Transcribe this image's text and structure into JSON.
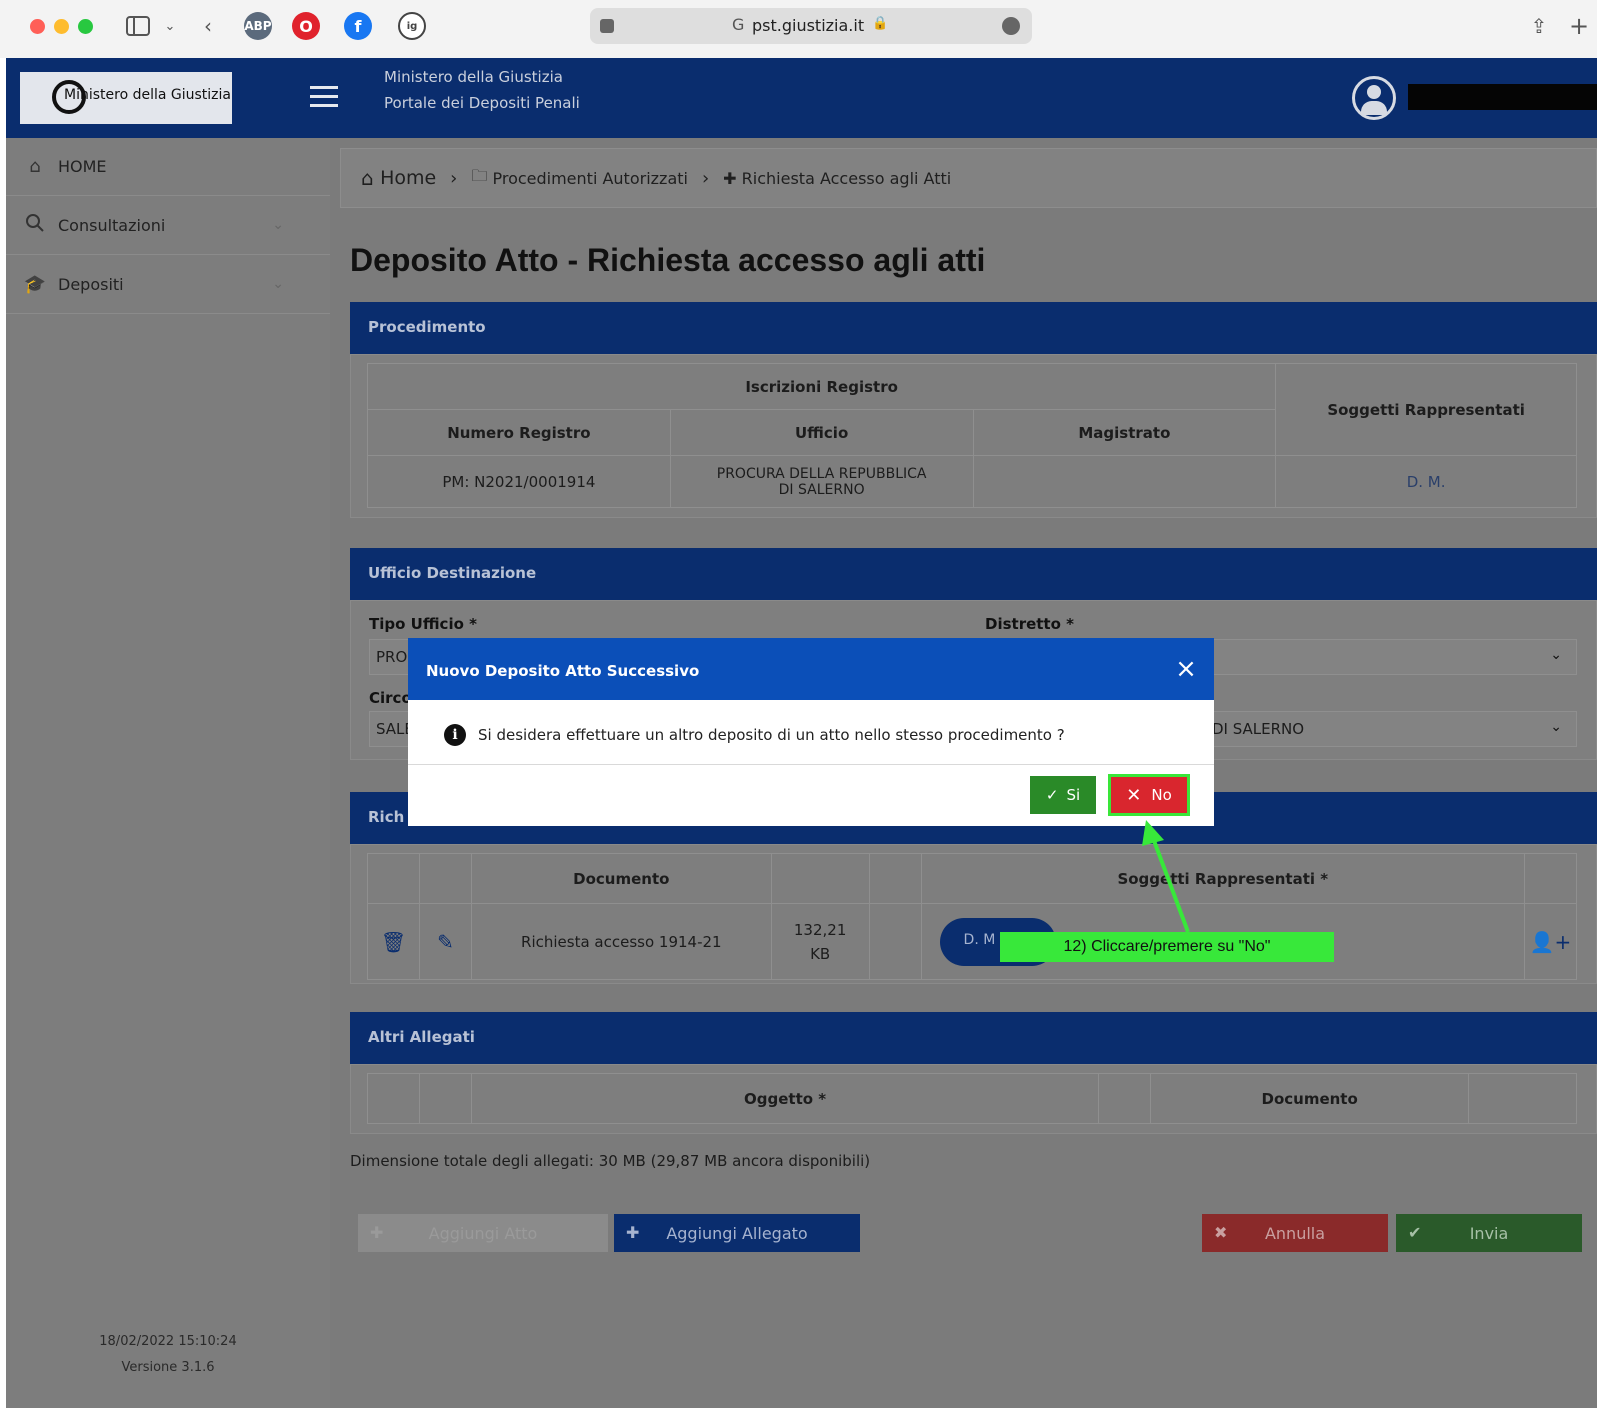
{
  "browser": {
    "url": "pst.giustizia.it",
    "extensions": [
      "ABP",
      "O",
      "f",
      "ig"
    ]
  },
  "header": {
    "logo_text": "Ministero della Giustizia",
    "title_line1": "Ministero della Giustizia",
    "title_line2": "Portale dei Depositi Penali"
  },
  "sidebar": {
    "items": [
      {
        "label": "HOME"
      },
      {
        "label": "Consultazioni"
      },
      {
        "label": "Depositi"
      }
    ],
    "footer_datetime": "18/02/2022 15:10:24",
    "footer_version": "Versione 3.1.6"
  },
  "breadcrumb": {
    "home": "Home",
    "level1": "Procedimenti Autorizzati",
    "level2": "Richiesta Accesso agli Atti"
  },
  "page": {
    "title": "Deposito Atto - Richiesta accesso agli atti"
  },
  "procedimento": {
    "heading": "Procedimento",
    "group_header": "Iscrizioni Registro",
    "col_soggetti": "Soggetti Rappresentati",
    "col_numero": "Numero Registro",
    "col_ufficio": "Ufficio",
    "col_magistrato": "Magistrato",
    "row": {
      "numero": "PM: N2021/0001914",
      "ufficio": "PROCURA DELLA REPUBBLICA DI SALERNO",
      "magistrato": "",
      "soggetti": "D. M."
    }
  },
  "ufficio_destinazione": {
    "heading": "Ufficio Destinazione",
    "tipo_label": "Tipo Ufficio *",
    "tipo_value": "PRO",
    "distretto_label": "Distretto *",
    "circ_label": "Circo",
    "circ_value": "SALE",
    "ufficio_value": "DI SALERNO"
  },
  "richiesta": {
    "heading": "Rich",
    "col_documento": "Documento",
    "col_soggetti": "Soggetti Rappresentati *",
    "row_documento": "Richiesta accesso 1914-21",
    "row_size_1": "132,21",
    "row_size_2": "KB",
    "row_soggetto": "D. M"
  },
  "altri_allegati": {
    "heading": "Altri Allegati",
    "col_oggetto": "Oggetto *",
    "col_documento": "Documento"
  },
  "footer": {
    "dimensione": "Dimensione totale degli allegati: 30 MB (29,87 MB ancora disponibili)",
    "btn_aggiungi_atto": "Aggiungi Atto",
    "btn_aggiungi_allegato": "Aggiungi Allegato",
    "btn_annulla": "Annulla",
    "btn_invia": "Invia"
  },
  "modal": {
    "title": "Nuovo Deposito Atto Successivo",
    "message": "Si desidera effettuare un altro deposito di un atto nello stesso procedimento ?",
    "btn_si": "Si",
    "btn_no": "No"
  },
  "annotation": {
    "text": "12) Cliccare/premere su \"No\""
  },
  "colors": {
    "header_navy": "#0a2d6e",
    "modal_blue": "#0b4fb8",
    "si_green": "#2a8a28",
    "no_red": "#d9262e",
    "annotation_green": "#38e83a"
  }
}
